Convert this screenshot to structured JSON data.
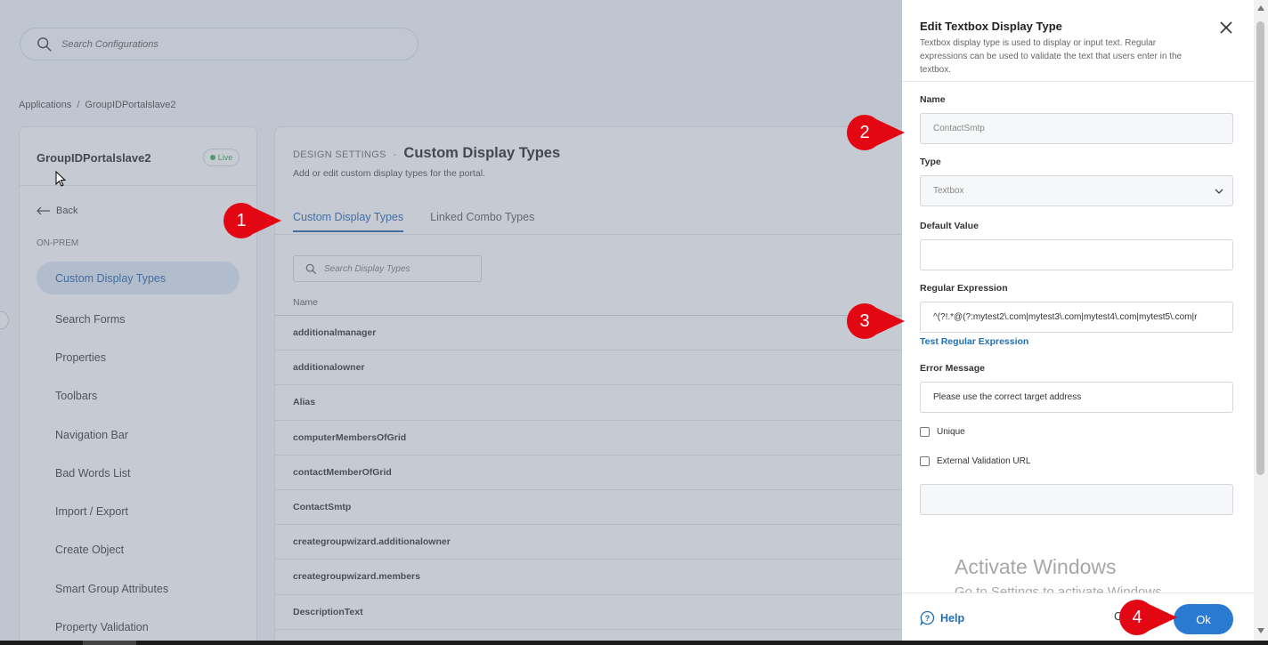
{
  "search": {
    "placeholder": "Search Configurations"
  },
  "breadcrumb": {
    "root": "Applications",
    "separator": "/",
    "current": "GroupIDPortalslave2"
  },
  "sidebar": {
    "title": "GroupIDPortalslave2",
    "badge": "Live",
    "back_label": "Back",
    "section": "ON-PREM",
    "items": [
      {
        "label": "Custom Display Types",
        "active": true
      },
      {
        "label": "Search Forms"
      },
      {
        "label": "Properties"
      },
      {
        "label": "Toolbars"
      },
      {
        "label": "Navigation Bar"
      },
      {
        "label": "Bad Words List"
      },
      {
        "label": "Import / Export"
      },
      {
        "label": "Create Object"
      },
      {
        "label": "Smart Group Attributes"
      },
      {
        "label": "Property Validation"
      }
    ]
  },
  "main": {
    "kicker": "DESIGN SETTINGS",
    "dash": "-",
    "title": "Custom Display Types",
    "subtitle": "Add or edit custom display types for the portal.",
    "tabs": [
      {
        "label": "Custom Display Types",
        "active": true
      },
      {
        "label": "Linked Combo Types"
      }
    ],
    "search_placeholder": "Search Display Types",
    "column_header": "Name",
    "rows": [
      "additionalmanager",
      "additionalowner",
      "Alias",
      "computerMembersOfGrid",
      "contactMemberOfGrid",
      "ContactSmtp",
      "creategroupwizard.additionalowner",
      "creategroupwizard.members",
      "DescriptionText"
    ]
  },
  "drawer": {
    "title": "Edit Textbox Display Type",
    "description": "Textbox display type is used to display or input text. Regular expressions can be used to validate the text that users enter in the textbox.",
    "name_label": "Name",
    "name_value": "ContactSmtp",
    "type_label": "Type",
    "type_value": "Textbox",
    "default_label": "Default Value",
    "default_value": "",
    "regex_label": "Regular Expression",
    "regex_value": "^(?!.*@(?:mytest2\\.com|mytest3\\.com|mytest4\\.com|mytest5\\.com|r",
    "test_link": "Test Regular Expression",
    "error_label": "Error Message",
    "error_value": "Please use the correct target address",
    "unique_label": "Unique",
    "external_label": "External Validation URL",
    "external_value": "",
    "help_label": "Help",
    "ok_label": "Ok",
    "cancel_peek": "C"
  },
  "watermark": {
    "line1": "Activate Windows",
    "line2": "Go to Settings to activate Windows."
  },
  "markers": [
    "1",
    "2",
    "3",
    "4"
  ],
  "colors": {
    "accent": "#1f5ea8",
    "ok_button": "#2a7ad1",
    "marker": "#e30613",
    "live": "#3aa94c"
  }
}
